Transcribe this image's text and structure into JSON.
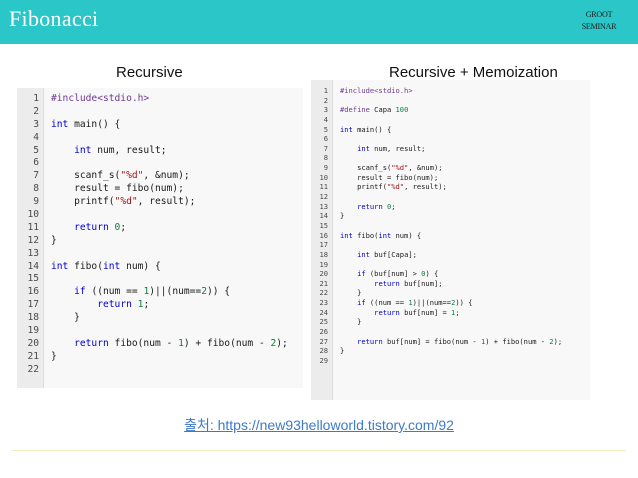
{
  "header": {
    "title": "Fibonacci",
    "logo_line1": "GROOT",
    "logo_line2": "SEMINAR"
  },
  "labels": {
    "left": "Recursive",
    "right": "Recursive + Memoization"
  },
  "left_code": [
    [
      {
        "t": "pp",
        "v": "#include<stdio.h>"
      }
    ],
    [],
    [
      {
        "t": "kw",
        "v": "int"
      },
      {
        "t": "n",
        "v": " main() {"
      }
    ],
    [],
    [
      {
        "t": "n",
        "v": "    "
      },
      {
        "t": "kw",
        "v": "int"
      },
      {
        "t": "n",
        "v": " num, result;"
      }
    ],
    [],
    [
      {
        "t": "n",
        "v": "    scanf_s("
      },
      {
        "t": "str",
        "v": "\"%d\""
      },
      {
        "t": "n",
        "v": ", &num);"
      }
    ],
    [
      {
        "t": "n",
        "v": "    result = fibo(num);"
      }
    ],
    [
      {
        "t": "n",
        "v": "    printf("
      },
      {
        "t": "str",
        "v": "\"%d\""
      },
      {
        "t": "n",
        "v": ", result);"
      }
    ],
    [],
    [
      {
        "t": "n",
        "v": "    "
      },
      {
        "t": "kw",
        "v": "return"
      },
      {
        "t": "n",
        "v": " "
      },
      {
        "t": "num",
        "v": "0"
      },
      {
        "t": "n",
        "v": ";"
      }
    ],
    [
      {
        "t": "n",
        "v": "}"
      }
    ],
    [],
    [
      {
        "t": "kw",
        "v": "int"
      },
      {
        "t": "n",
        "v": " fibo("
      },
      {
        "t": "kw",
        "v": "int"
      },
      {
        "t": "n",
        "v": " num) {"
      }
    ],
    [],
    [
      {
        "t": "n",
        "v": "    "
      },
      {
        "t": "kw",
        "v": "if"
      },
      {
        "t": "n",
        "v": " ((num == "
      },
      {
        "t": "num",
        "v": "1"
      },
      {
        "t": "n",
        "v": ")||(num=="
      },
      {
        "t": "num",
        "v": "2"
      },
      {
        "t": "n",
        "v": ")) {"
      }
    ],
    [
      {
        "t": "n",
        "v": "        "
      },
      {
        "t": "kw",
        "v": "return"
      },
      {
        "t": "n",
        "v": " "
      },
      {
        "t": "num",
        "v": "1"
      },
      {
        "t": "n",
        "v": ";"
      }
    ],
    [
      {
        "t": "n",
        "v": "    }"
      }
    ],
    [],
    [
      {
        "t": "n",
        "v": "    "
      },
      {
        "t": "kw",
        "v": "return"
      },
      {
        "t": "n",
        "v": " fibo(num - "
      },
      {
        "t": "num",
        "v": "1"
      },
      {
        "t": "n",
        "v": ") + fibo(num - "
      },
      {
        "t": "num",
        "v": "2"
      },
      {
        "t": "n",
        "v": ");"
      }
    ],
    [
      {
        "t": "n",
        "v": "}"
      }
    ],
    []
  ],
  "right_code": [
    [
      {
        "t": "pp",
        "v": "#include<stdio.h>"
      }
    ],
    [],
    [
      {
        "t": "pp",
        "v": "#define"
      },
      {
        "t": "n",
        "v": " Capa "
      },
      {
        "t": "num",
        "v": "100"
      }
    ],
    [],
    [
      {
        "t": "kw",
        "v": "int"
      },
      {
        "t": "n",
        "v": " main() {"
      }
    ],
    [],
    [
      {
        "t": "n",
        "v": "    "
      },
      {
        "t": "kw",
        "v": "int"
      },
      {
        "t": "n",
        "v": " num, result;"
      }
    ],
    [],
    [
      {
        "t": "n",
        "v": "    scanf_s("
      },
      {
        "t": "str",
        "v": "\"%d\""
      },
      {
        "t": "n",
        "v": ", &num);"
      }
    ],
    [
      {
        "t": "n",
        "v": "    result = fibo(num);"
      }
    ],
    [
      {
        "t": "n",
        "v": "    printf("
      },
      {
        "t": "str",
        "v": "\"%d\""
      },
      {
        "t": "n",
        "v": ", result);"
      }
    ],
    [],
    [
      {
        "t": "n",
        "v": "    "
      },
      {
        "t": "kw",
        "v": "return"
      },
      {
        "t": "n",
        "v": " "
      },
      {
        "t": "num",
        "v": "0"
      },
      {
        "t": "n",
        "v": ";"
      }
    ],
    [
      {
        "t": "n",
        "v": "}"
      }
    ],
    [],
    [
      {
        "t": "kw",
        "v": "int"
      },
      {
        "t": "n",
        "v": " fibo("
      },
      {
        "t": "kw",
        "v": "int"
      },
      {
        "t": "n",
        "v": " num) {"
      }
    ],
    [],
    [
      {
        "t": "n",
        "v": "    "
      },
      {
        "t": "kw",
        "v": "int"
      },
      {
        "t": "n",
        "v": " buf[Capa];"
      }
    ],
    [],
    [
      {
        "t": "n",
        "v": "    "
      },
      {
        "t": "kw",
        "v": "if"
      },
      {
        "t": "n",
        "v": " (buf[num] > "
      },
      {
        "t": "num",
        "v": "0"
      },
      {
        "t": "n",
        "v": ") {"
      }
    ],
    [
      {
        "t": "n",
        "v": "        "
      },
      {
        "t": "kw",
        "v": "return"
      },
      {
        "t": "n",
        "v": " buf[num];"
      }
    ],
    [
      {
        "t": "n",
        "v": "    }"
      }
    ],
    [
      {
        "t": "n",
        "v": "    "
      },
      {
        "t": "kw",
        "v": "if"
      },
      {
        "t": "n",
        "v": " ((num == "
      },
      {
        "t": "num",
        "v": "1"
      },
      {
        "t": "n",
        "v": ")||(num=="
      },
      {
        "t": "num",
        "v": "2"
      },
      {
        "t": "n",
        "v": ")) {"
      }
    ],
    [
      {
        "t": "n",
        "v": "        "
      },
      {
        "t": "kw",
        "v": "return"
      },
      {
        "t": "n",
        "v": " buf[num] = "
      },
      {
        "t": "num",
        "v": "1"
      },
      {
        "t": "n",
        "v": ";"
      }
    ],
    [
      {
        "t": "n",
        "v": "    }"
      }
    ],
    [],
    [
      {
        "t": "n",
        "v": "    "
      },
      {
        "t": "kw",
        "v": "return"
      },
      {
        "t": "n",
        "v": " buf[num] = fibo(num - "
      },
      {
        "t": "num",
        "v": "1"
      },
      {
        "t": "n",
        "v": ") + fibo(num - "
      },
      {
        "t": "num",
        "v": "2"
      },
      {
        "t": "n",
        "v": ");"
      }
    ],
    [
      {
        "t": "n",
        "v": "}"
      }
    ],
    []
  ],
  "source": {
    "text": "출처: https://new93helloworld.tistory.com/92"
  },
  "colors": {
    "header_bg": "#2bc6c8",
    "keyword": "#0000d0",
    "preprocessor": "#6f3a8e",
    "string": "#a31515",
    "number": "#0a8040",
    "link": "#3d7ac8"
  }
}
